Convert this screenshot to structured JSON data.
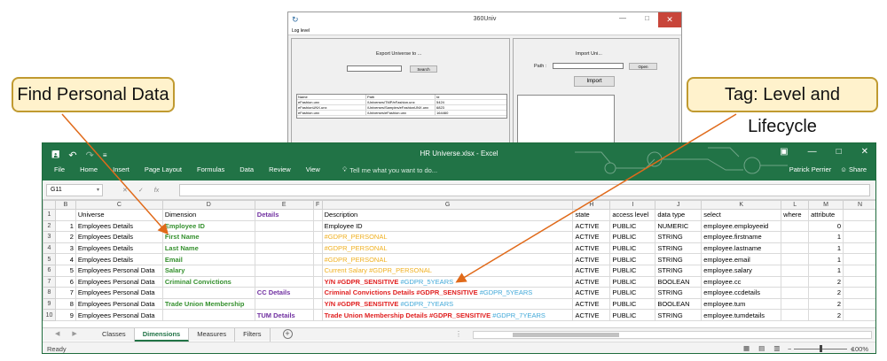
{
  "univ_window": {
    "title": "360Univ",
    "menu": "Log level",
    "export_label": "Export Universe to ...",
    "search_button": "Search",
    "import_label": "Import Uni...",
    "path_label": "Path :",
    "open_button": "Open",
    "import_button": "Import",
    "table": {
      "headers": [
        "Name",
        "Path",
        "Id"
      ],
      "rows": [
        [
          "eFashion.unx",
          "/Universes/TMP/eFashion.unx",
          "5424"
        ],
        [
          "eFashionUNX.unx",
          "/Universes/Samples/eFashionUNX.unx",
          "6823"
        ],
        [
          "eFashion.unx",
          "/Universes/eFashion.unx",
          "164460"
        ]
      ]
    }
  },
  "callouts": {
    "left": "Find Personal Data",
    "right": "Tag: Level and Lifecycle"
  },
  "excel": {
    "doc_title": "HR Universe.xlsx  -  Excel",
    "tabs": [
      "File",
      "Home",
      "Insert",
      "Page Layout",
      "Formulas",
      "Data",
      "Review",
      "View"
    ],
    "tell_me": "Tell me what you want to do...",
    "user": "Patrick Perrier",
    "share": "Share",
    "name_box": "G11",
    "columns": [
      "",
      "B",
      "C",
      "D",
      "E",
      "F",
      "G",
      "H",
      "I",
      "J",
      "K",
      "L",
      "M",
      "N"
    ],
    "rows": [
      {
        "n": "1",
        "b": "",
        "c": "Universe",
        "d": "Dimension",
        "e": "Details",
        "g": "Description",
        "h": "state",
        "i": "access level",
        "j": "data type",
        "k": "select",
        "l": "where",
        "m": "attribute"
      },
      {
        "n": "2",
        "b": "1",
        "c": "Employees Details",
        "d": "Employee ID",
        "e": "",
        "g": "Employee ID",
        "h": "ACTIVE",
        "i": "PUBLIC",
        "j": "NUMERIC",
        "k": "employee.employeeid",
        "l": "",
        "m": "0"
      },
      {
        "n": "3",
        "b": "2",
        "c": "Employees Details",
        "d": "First Name",
        "e": "",
        "g": "#GDPR_PERSONAL",
        "h": "ACTIVE",
        "i": "PUBLIC",
        "j": "STRING",
        "k": "employee.firstname",
        "l": "",
        "m": "1"
      },
      {
        "n": "4",
        "b": "3",
        "c": "Employees Details",
        "d": "Last Name",
        "e": "",
        "g": "#GDPR_PERSONAL",
        "h": "ACTIVE",
        "i": "PUBLIC",
        "j": "STRING",
        "k": "employee.lastname",
        "l": "",
        "m": "1"
      },
      {
        "n": "5",
        "b": "4",
        "c": "Employees Details",
        "d": "Email",
        "e": "",
        "g": "#GDPR_PERSONAL",
        "h": "ACTIVE",
        "i": "PUBLIC",
        "j": "STRING",
        "k": "employee.email",
        "l": "",
        "m": "1"
      },
      {
        "n": "6",
        "b": "5",
        "c": "Employees Personal Data",
        "d": "Salary",
        "e": "",
        "g": "Current Salary #GDPR_PERSONAL",
        "h": "ACTIVE",
        "i": "PUBLIC",
        "j": "STRING",
        "k": "employee.salary",
        "l": "",
        "m": "1"
      },
      {
        "n": "7",
        "b": "6",
        "c": "Employees Personal Data",
        "d": "Criminal Convictions",
        "e": "",
        "g_red": "Y/N #GDPR_SENSITIVE ",
        "g_blue": "#GDPR_5YEARS",
        "h": "ACTIVE",
        "i": "PUBLIC",
        "j": "BOOLEAN",
        "k": "employee.cc",
        "l": "",
        "m": "2"
      },
      {
        "n": "8",
        "b": "7",
        "c": "Employees Personal Data",
        "d": "",
        "e": "CC Details",
        "g_red": "Criminal Convictions Details #GDPR_SENSITIVE ",
        "g_blue": "#GDPR_5YEARS",
        "h": "ACTIVE",
        "i": "PUBLIC",
        "j": "STRING",
        "k": "employee.ccdetails",
        "l": "",
        "m": "2"
      },
      {
        "n": "9",
        "b": "8",
        "c": "Employees Personal Data",
        "d": "Trade Union Membership",
        "e": "",
        "g_red": "Y/N #GDPR_SENSITIVE ",
        "g_blue": "#GDPR_7YEARS",
        "h": "ACTIVE",
        "i": "PUBLIC",
        "j": "BOOLEAN",
        "k": "employee.tum",
        "l": "",
        "m": "2"
      },
      {
        "n": "10",
        "b": "9",
        "c": "Employees Personal Data",
        "d": "",
        "e": "TUM Details",
        "g_red": "Trade Union Membership Details #GDPR_SENSITIVE ",
        "g_blue": "#GDPR_7YEARS",
        "h": "ACTIVE",
        "i": "PUBLIC",
        "j": "STRING",
        "k": "employee.tumdetails",
        "l": "",
        "m": "2"
      }
    ],
    "sheet_tabs": [
      "Classes",
      "Dimensions",
      "Measures",
      "Filters"
    ],
    "active_sheet": "Dimensions",
    "status": "Ready",
    "zoom": "100%",
    "zoom_fraction": 0.5
  }
}
